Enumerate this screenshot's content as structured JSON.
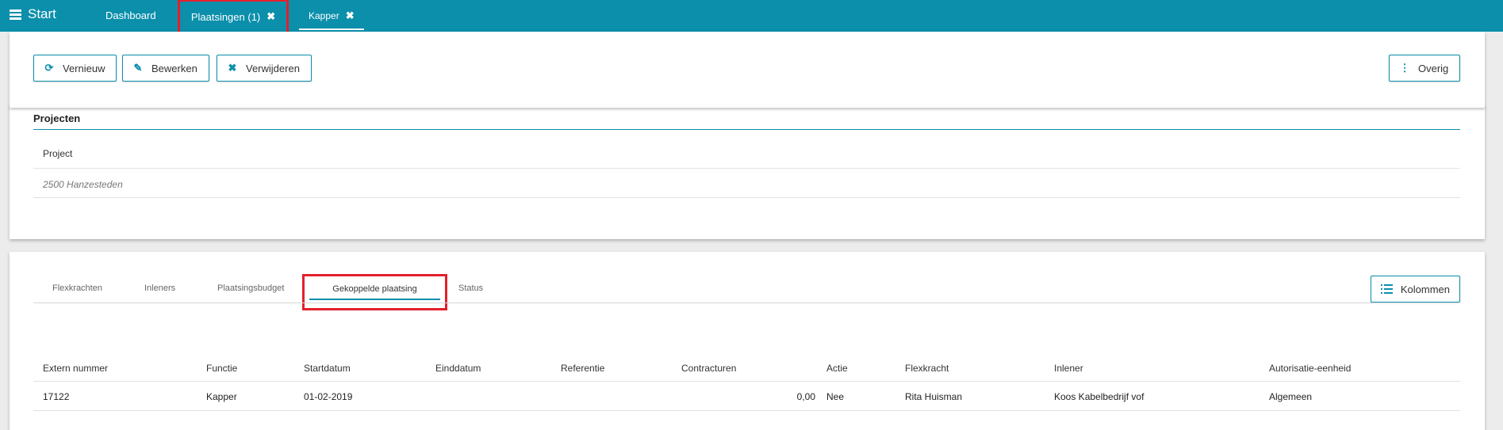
{
  "topbar": {
    "start_label": "Start",
    "tabs": [
      {
        "label": "Dashboard"
      },
      {
        "label": "Plaatsingen (1)",
        "close": "✖"
      },
      {
        "label": "Kapper",
        "close": "✖"
      }
    ]
  },
  "toolbar": {
    "vernieuw": "Vernieuw",
    "bewerken": "Bewerken",
    "verwijderen": "Verwijderen",
    "overig": "Overig"
  },
  "projecten": {
    "title": "Projecten",
    "column": "Project",
    "value": "2500 Hanzesteden"
  },
  "subtabs": [
    "Flexkrachten",
    "Inleners",
    "Plaatsingsbudget",
    "Gekoppelde plaatsing",
    "Status"
  ],
  "kolommen_label": "Kolommen",
  "table": {
    "headers": [
      "Extern nummer",
      "Functie",
      "Startdatum",
      "Einddatum",
      "Referentie",
      "Contracturen",
      "Actie",
      "Flexkracht",
      "Inlener",
      "Autorisatie-eenheid"
    ],
    "rows": [
      [
        "17122",
        "Kapper",
        "01-02-2019",
        "",
        "",
        "0,00",
        "Nee",
        "Rita Huisman",
        "Koos Kabelbedrijf vof",
        "Algemeen"
      ]
    ]
  },
  "colors": {
    "accent": "#0b8fab",
    "highlight": "#e3202b"
  }
}
